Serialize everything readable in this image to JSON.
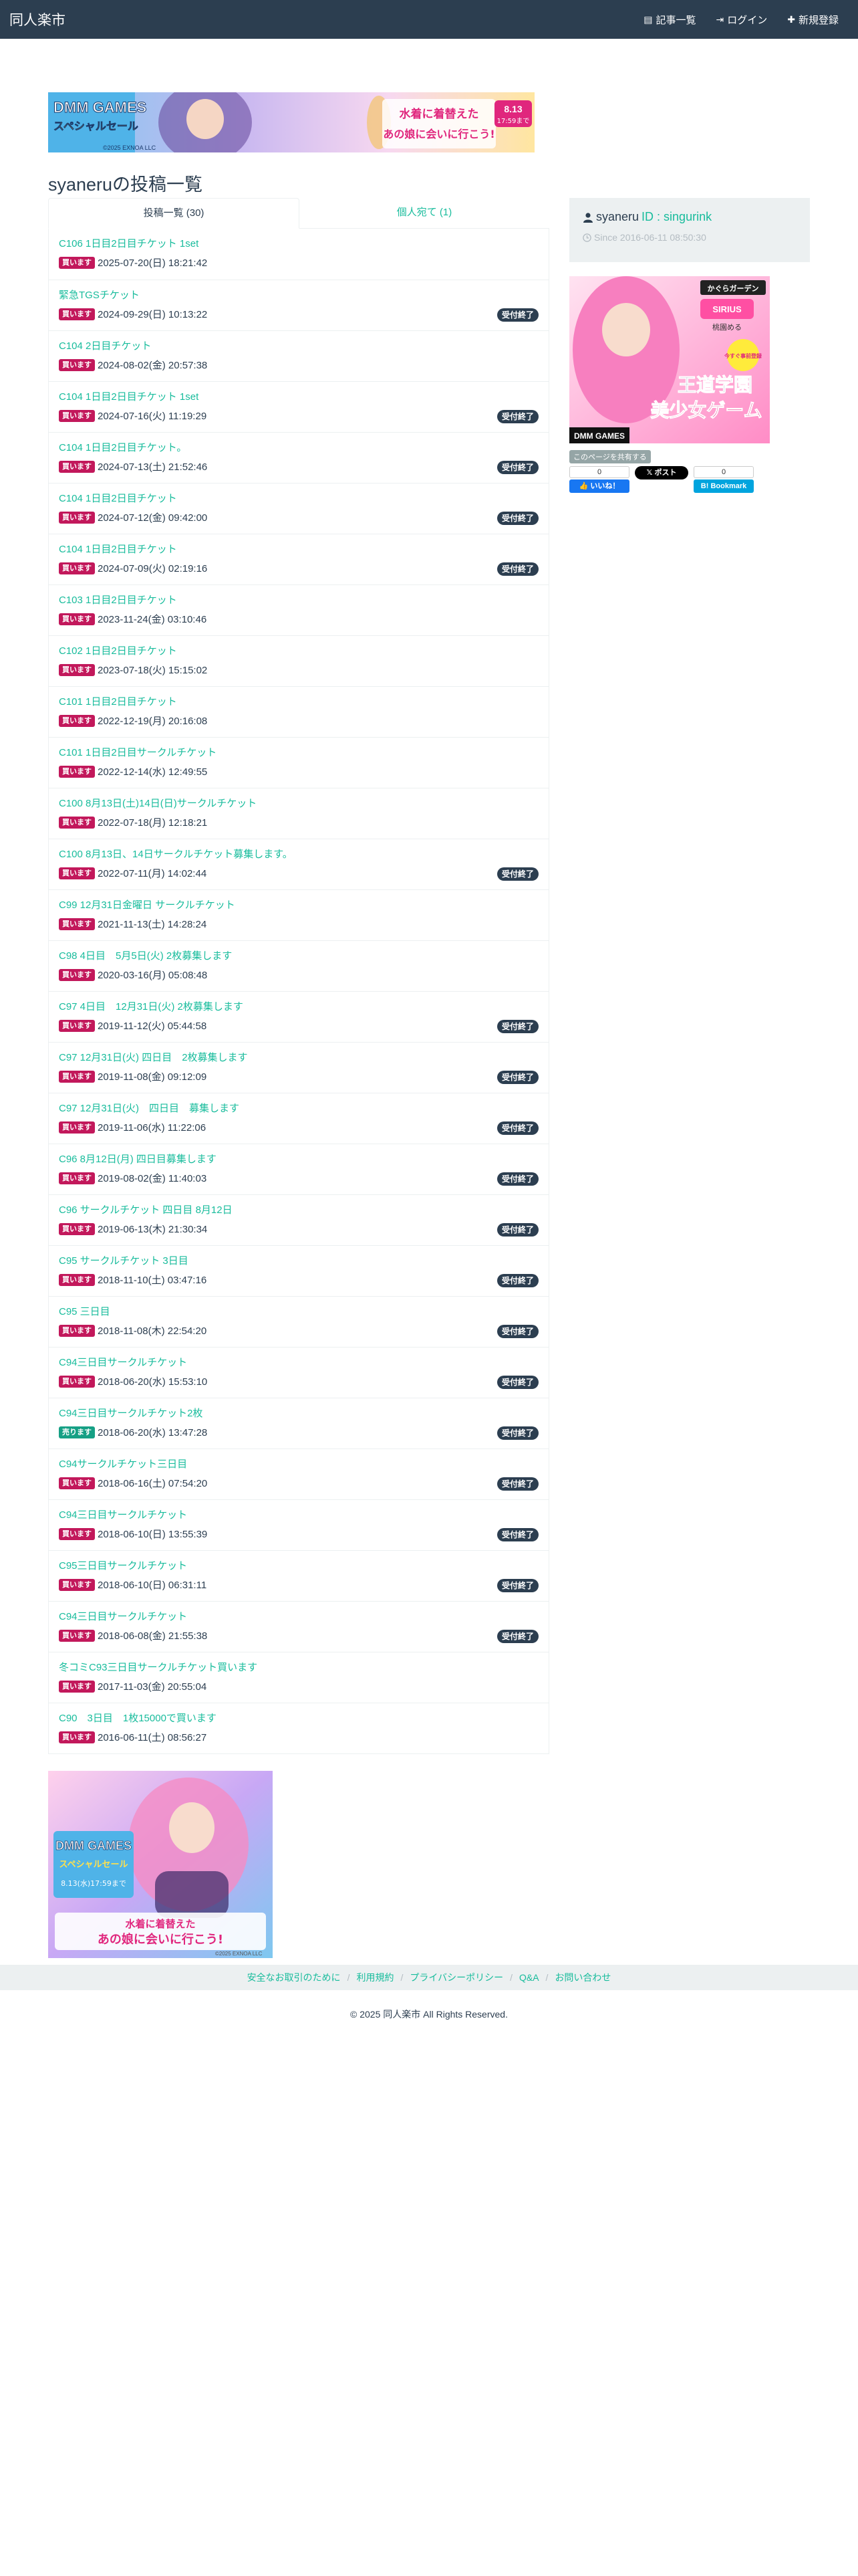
{
  "nav": {
    "brand": "同人楽市",
    "links": [
      {
        "icon": "list-icon",
        "glyph": "▤",
        "label": "記事一覧"
      },
      {
        "icon": "login-icon",
        "glyph": "⇥",
        "label": "ログイン"
      },
      {
        "icon": "plus-icon",
        "glyph": "✚",
        "label": "新規登録"
      }
    ]
  },
  "page_title": "syaneruの投稿一覧",
  "tabs": [
    {
      "label": "投稿一覧 (30)",
      "active": true
    },
    {
      "label": "個人宛て (1)",
      "active": false
    }
  ],
  "posts": [
    {
      "title": "C106 1日目2日目チケット 1set",
      "tag": "買います",
      "date": "2025-07-20(日) 18:21:42",
      "closed": false
    },
    {
      "title": "緊急TGSチケット",
      "tag": "買います",
      "date": "2024-09-29(日) 10:13:22",
      "closed": true
    },
    {
      "title": "C104 2日目チケット",
      "tag": "買います",
      "date": "2024-08-02(金) 20:57:38",
      "closed": false
    },
    {
      "title": "C104 1日目2日目チケット 1set",
      "tag": "買います",
      "date": "2024-07-16(火) 11:19:29",
      "closed": true
    },
    {
      "title": "C104 1日目2日目チケット。",
      "tag": "買います",
      "date": "2024-07-13(土) 21:52:46",
      "closed": true
    },
    {
      "title": "C104 1日目2日目チケット",
      "tag": "買います",
      "date": "2024-07-12(金) 09:42:00",
      "closed": true
    },
    {
      "title": "C104 1日目2日目チケット",
      "tag": "買います",
      "date": "2024-07-09(火) 02:19:16",
      "closed": true
    },
    {
      "title": "C103 1日目2日目チケット",
      "tag": "買います",
      "date": "2023-11-24(金) 03:10:46",
      "closed": false
    },
    {
      "title": "C102 1日目2日目チケット",
      "tag": "買います",
      "date": "2023-07-18(火) 15:15:02",
      "closed": false
    },
    {
      "title": "C101 1日目2日目チケット",
      "tag": "買います",
      "date": "2022-12-19(月) 20:16:08",
      "closed": false
    },
    {
      "title": "C101 1日目2日目サークルチケット",
      "tag": "買います",
      "date": "2022-12-14(水) 12:49:55",
      "closed": false
    },
    {
      "title": "C100 8月13日(土)14日(日)サークルチケット",
      "tag": "買います",
      "date": "2022-07-18(月) 12:18:21",
      "closed": false
    },
    {
      "title": "C100 8月13日、14日サークルチケット募集します。",
      "tag": "買います",
      "date": "2022-07-11(月) 14:02:44",
      "closed": true
    },
    {
      "title": "C99 12月31日金曜日 サークルチケット",
      "tag": "買います",
      "date": "2021-11-13(土) 14:28:24",
      "closed": false
    },
    {
      "title": "C98 4日目　5月5日(火) 2枚募集します",
      "tag": "買います",
      "date": "2020-03-16(月) 05:08:48",
      "closed": false
    },
    {
      "title": "C97 4日目　12月31日(火) 2枚募集します",
      "tag": "買います",
      "date": "2019-11-12(火) 05:44:58",
      "closed": true
    },
    {
      "title": "C97 12月31日(火) 四日目　2枚募集します",
      "tag": "買います",
      "date": "2019-11-08(金) 09:12:09",
      "closed": true
    },
    {
      "title": "C97 12月31日(火)　四日目　募集します",
      "tag": "買います",
      "date": "2019-11-06(水) 11:22:06",
      "closed": true
    },
    {
      "title": "C96 8月12日(月) 四日目募集します",
      "tag": "買います",
      "date": "2019-08-02(金) 11:40:03",
      "closed": true
    },
    {
      "title": "C96 サークルチケット 四日目 8月12日",
      "tag": "買います",
      "date": "2019-06-13(木) 21:30:34",
      "closed": true
    },
    {
      "title": "C95 サークルチケット 3日目",
      "tag": "買います",
      "date": "2018-11-10(土) 03:47:16",
      "closed": true
    },
    {
      "title": "C95 三日目",
      "tag": "買います",
      "date": "2018-11-08(木) 22:54:20",
      "closed": true
    },
    {
      "title": "C94三日目サークルチケット",
      "tag": "買います",
      "date": "2018-06-20(水) 15:53:10",
      "closed": true
    },
    {
      "title": "C94三日目サークルチケット2枚",
      "tag": "売ります",
      "date": "2018-06-20(水) 13:47:28",
      "closed": true
    },
    {
      "title": "C94サークルチケット三日目",
      "tag": "買います",
      "date": "2018-06-16(土) 07:54:20",
      "closed": true
    },
    {
      "title": "C94三日目サークルチケット",
      "tag": "買います",
      "date": "2018-06-10(日) 13:55:39",
      "closed": true
    },
    {
      "title": "C95三日目サークルチケット",
      "tag": "買います",
      "date": "2018-06-10(日) 06:31:11",
      "closed": true
    },
    {
      "title": "C94三日目サークルチケット",
      "tag": "買います",
      "date": "2018-06-08(金) 21:55:38",
      "closed": true
    },
    {
      "title": "冬コミC93三日目サークルチケット買います",
      "tag": "買います",
      "date": "2017-11-03(金) 20:55:04",
      "closed": false
    },
    {
      "title": "C90　3日目　1枚15000で買います",
      "tag": "買います",
      "date": "2016-06-11(土) 08:56:27",
      "closed": false
    }
  ],
  "closed_label": "受付終了",
  "profile": {
    "name": "syaneru",
    "id_text": "ID : singurink",
    "since": "Since 2016-06-11 08:50:30"
  },
  "top_banner": {
    "line1": "DMM GAMES",
    "line2": "スペシャルセール",
    "copyright": "©2025 EXNOA LLC",
    "catch": "水着に着替えた",
    "catch2": "あの娘に会いに行こう!",
    "date1": "8.13",
    "date2": "17:59まで"
  },
  "side_banner": {
    "brand": "かぐらガーデン",
    "tag": "SIRIUS",
    "voice": "桃園める",
    "cta": "今すぐ事前登録",
    "title1": "王道学園",
    "title2": "美少女ゲーム",
    "footer": "DMM GAMES"
  },
  "bottom_banner": {
    "line1": "DMM GAMES",
    "line2": "スペシャルセール",
    "date": "8.13(水)17:59まで",
    "catch": "水着に着替えた",
    "catch2": "あの娘に会いに行こう!",
    "copyright": "©2025 EXNOA LLC"
  },
  "share": {
    "label": "このページを共有する",
    "fb_count": "0",
    "fb_label": "いいね！",
    "x_label": "ポスト",
    "hb_count": "0",
    "hb_label": "Bookmark"
  },
  "footer": {
    "links": [
      "安全なお取引のために",
      "利用規約",
      "プライバシーポリシー",
      "Q&A",
      "お問い合わせ"
    ],
    "copyright": "© 2025 同人楽市 All Rights Reserved."
  },
  "colors": {
    "navbar": "#2c3e50",
    "accent": "#18bc9c",
    "buy_tag": "#c2185b",
    "sell_tag": "#16a085",
    "closed_badge": "#2c3e50"
  }
}
